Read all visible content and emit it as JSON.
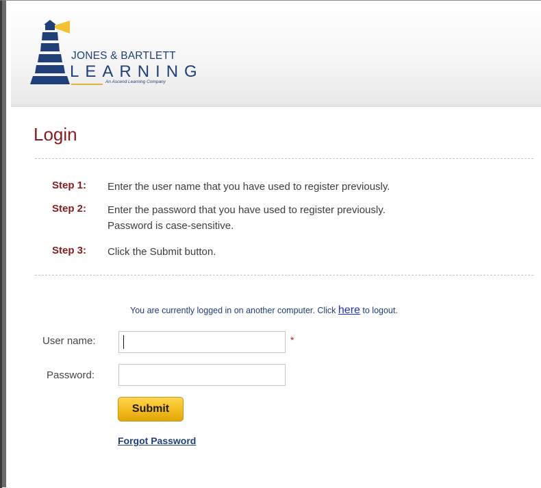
{
  "brand": {
    "line1": "JONES & BARTLETT",
    "line2": "LEARNING",
    "tagline": "An Ascend Learning Company"
  },
  "page": {
    "title": "Login"
  },
  "steps": [
    {
      "label": "Step 1:",
      "lines": [
        "Enter the user name that you have used to register previously."
      ]
    },
    {
      "label": "Step 2:",
      "lines": [
        "Enter the password that you have used to register previously.",
        "Password is case-sensitive."
      ]
    },
    {
      "label": "Step 3:",
      "lines": [
        "Click the Submit button."
      ]
    }
  ],
  "notice": {
    "before": "You are currently logged in on another computer. Click ",
    "link": "here",
    "after": " to logout."
  },
  "form": {
    "username_label": "User name:",
    "username_value": "",
    "required_marker": "*",
    "password_label": "Password:",
    "password_value": "",
    "submit_label": "Submit",
    "forgot_label": "Forgot Password"
  },
  "colors": {
    "title": "#8b1a1a",
    "step_label": "#8b1a1a",
    "link": "#1d3f7c",
    "brand": "#1f3f7a",
    "button": "#f3bc1c"
  },
  "icons": {
    "logo": "lighthouse-logo"
  }
}
